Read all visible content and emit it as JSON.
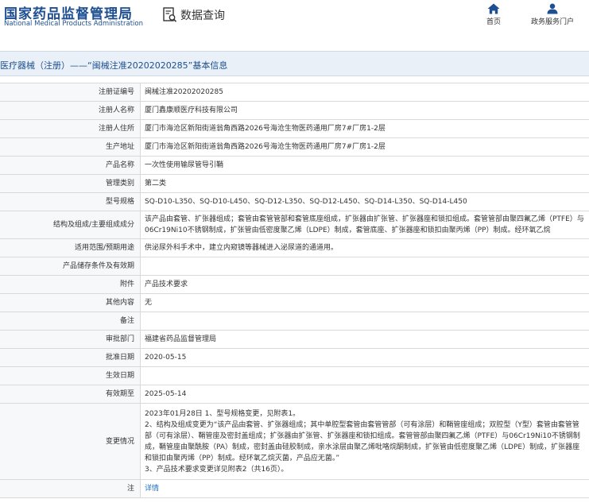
{
  "header": {
    "logo_cn": "国家药品监督管理局",
    "logo_en": "National Medical Products Administration",
    "data_query_label": "数据查询",
    "nav": {
      "home_label": "首页",
      "portal_label": "政务服务门户"
    }
  },
  "title_bar": {
    "text": "医疗器械（注册）——“闽械注准20202020285”基本信息"
  },
  "rows": [
    {
      "key": "注册证编号",
      "value": "闽械注准20202020285"
    },
    {
      "key": "注册人名称",
      "value": "厦门鑫康顺医疗科技有限公司"
    },
    {
      "key": "注册人住所",
      "value": "厦门市海沧区新阳街道翁角西路2026号海沧生物医药通用厂房7#厂房1-2层"
    },
    {
      "key": "生产地址",
      "value": "厦门市海沧区新阳街道翁角西路2026号海沧生物医药通用厂房7#厂房1-2层"
    },
    {
      "key": "产品名称",
      "value": "一次性使用输尿管导引鞘"
    },
    {
      "key": "管理类别",
      "value": "第二类"
    },
    {
      "key": "型号规格",
      "value": "SQ-D10-L350、SQ-D10-L450、SQ-D12-L350、SQ-D12-L450、SQ-D14-L350、SQ-D14-L450"
    },
    {
      "key": "结构及组成/主要组成成分",
      "value": "该产品由套管、扩张器组成；套管由套管管部和套管底座组成，扩张器由扩张管、扩张器座和锁扣组成。套管管部由聚四氟乙烯（PTFE）与06Cr19Ni10不锈钢制成，扩张管由低密度聚乙烯（LDPE）制成，套管底座、扩张器座和锁扣由聚丙烯（PP）制成。经环氧乙烷"
    },
    {
      "key": "适用范围/预期用途",
      "value": "供泌尿外科手术中，建立内窥镜等器械进入泌尿道的通道用。"
    },
    {
      "key": "产品储存条件及有效期",
      "value": ""
    },
    {
      "key": "附件",
      "value": "产品技术要求"
    },
    {
      "key": "其他内容",
      "value": "无"
    },
    {
      "key": "备注",
      "value": ""
    },
    {
      "key": "审批部门",
      "value": "福建省药品监督管理局"
    },
    {
      "key": "批准日期",
      "value": "2020-05-15"
    },
    {
      "key": "生效日期",
      "value": ""
    },
    {
      "key": "有效期至",
      "value": "2025-05-14"
    }
  ],
  "change_row": {
    "key": "变更情况",
    "lines": [
      "2023年01月28日 1、型号规格变更，见附表1。",
      "2、结构及组成变更为“该产品由套管、扩张器组成；其中单腔型套管由套管管部（可有涂层）和鞘管座组成；双腔型（Y型）套管由套管管部（可有涂层）、鞘管座及密封盖组成；扩张器由扩张管、扩张器座和锁扣组成。套管管部由聚四氟乙烯（PTFE）与06Cr19Ni10不锈钢制成，鞘管座由聚酰胺（PA）制成，密封盖由硅胶制成，亲水涂层由聚乙烯吡咯烷酮制成，扩张管由低密度聚乙烯（LDPE）制成，扩张器座和锁扣由聚丙烯（PP）制成。经环氧乙烷灭菌，产品应无菌。”",
      "3、产品技术要求变更详见附表2（共16页）。"
    ]
  },
  "last_row": {
    "key": "注",
    "link_label": "详情"
  }
}
